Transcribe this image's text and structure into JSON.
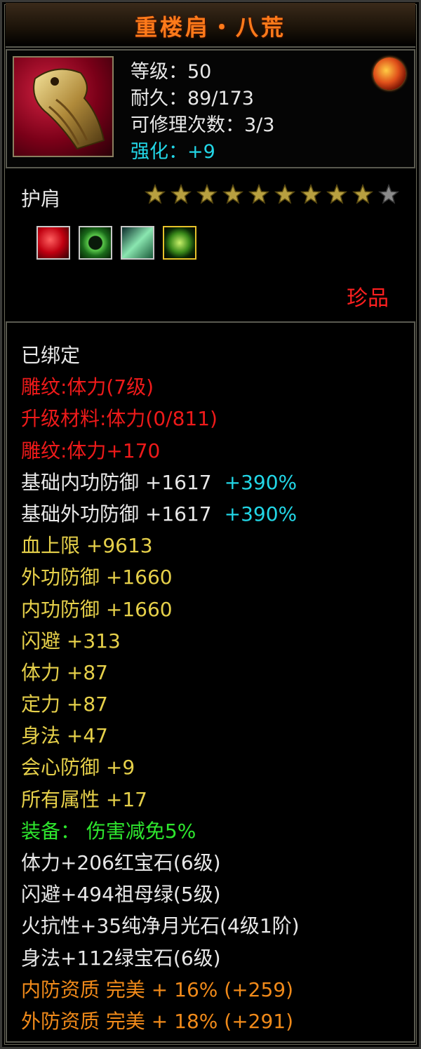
{
  "title": "重楼肩・八荒",
  "header": {
    "level": "等级：50",
    "durability": "耐久：89/173",
    "repair": "可修理次数：3/3",
    "enhance": "强化：+9"
  },
  "item_type": "护肩",
  "stars": {
    "filled": 9,
    "total": 10
  },
  "gems": [
    "ruby-gem-icon",
    "emerald-ring-gem-icon",
    "jade-crystal-gem-icon",
    "green-round-gem-icon"
  ],
  "rarity": "珍品",
  "colors": {
    "title": "#ff7a1a",
    "red": "#ee1a1a",
    "yellow": "#e6d04a",
    "green": "#2ee62e",
    "orange": "#f08a1a",
    "cyan": "#22d6e6"
  },
  "attributes": [
    {
      "text": "已绑定",
      "extra": "",
      "color": "white"
    },
    {
      "text": "雕纹:体力(7级)",
      "extra": "",
      "color": "red"
    },
    {
      "text": "升级材料:体力(0/811)",
      "extra": "",
      "color": "red"
    },
    {
      "text": "雕纹:体力+170",
      "extra": "",
      "color": "red"
    },
    {
      "text": "基础内功防御 +1617",
      "extra": "+390%",
      "color": "white"
    },
    {
      "text": "基础外功防御 +1617",
      "extra": "+390%",
      "color": "white"
    },
    {
      "text": "血上限 +9613",
      "extra": "",
      "color": "yellow"
    },
    {
      "text": "外功防御 +1660",
      "extra": "",
      "color": "yellow"
    },
    {
      "text": "内功防御 +1660",
      "extra": "",
      "color": "yellow"
    },
    {
      "text": "闪避 +313",
      "extra": "",
      "color": "yellow"
    },
    {
      "text": "体力 +87",
      "extra": "",
      "color": "yellow"
    },
    {
      "text": "定力 +87",
      "extra": "",
      "color": "yellow"
    },
    {
      "text": "身法 +47",
      "extra": "",
      "color": "yellow"
    },
    {
      "text": "会心防御 +9",
      "extra": "",
      "color": "yellow"
    },
    {
      "text": "所有属性 +17",
      "extra": "",
      "color": "yellow"
    },
    {
      "text": "装备： 伤害减免5%",
      "extra": "",
      "color": "green"
    },
    {
      "text": "体力+206红宝石(6级)",
      "extra": "",
      "color": "white"
    },
    {
      "text": "闪避+494祖母绿(5级)",
      "extra": "",
      "color": "white"
    },
    {
      "text": "火抗性+35纯净月光石(4级1阶)",
      "extra": "",
      "color": "white"
    },
    {
      "text": "身法+112绿宝石(6级)",
      "extra": "",
      "color": "white"
    },
    {
      "text": "内防资质 完美 + 16% (+259)",
      "extra": "",
      "color": "orange"
    },
    {
      "text": "外防资质 完美 + 18% (+291)",
      "extra": "",
      "color": "orange"
    }
  ]
}
